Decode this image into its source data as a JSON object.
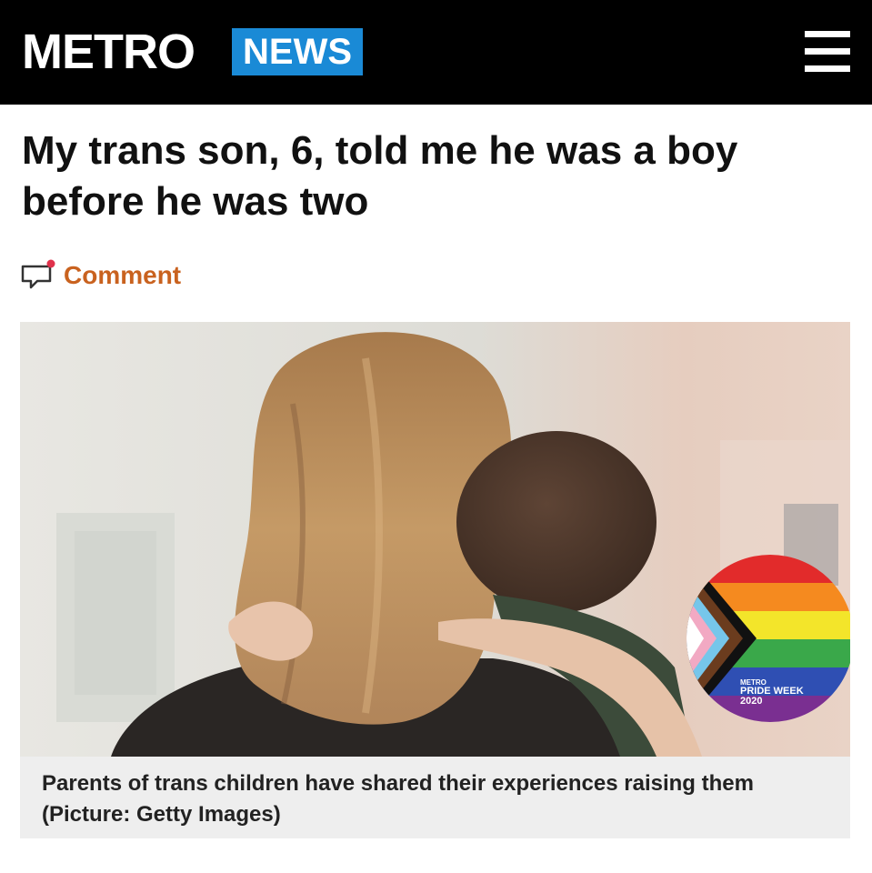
{
  "header": {
    "logo_text": "METRO",
    "section_label": "NEWS",
    "menu_icon": "hamburger-menu-icon",
    "background_color": "#000000",
    "section_color": "#1a8ad6"
  },
  "article": {
    "headline": "My trans son, 6, told me he was a boy before he was two",
    "comment_icon": "comment-bubble-icon",
    "comment_label": "Comment",
    "comment_color": "#c9621f"
  },
  "hero_image": {
    "badge_brand": "METRO",
    "badge_line_1": "PRIDE WEEK",
    "badge_line_2": "2020"
  },
  "caption": {
    "text": "Parents of trans children have shared their experiences raising them (Picture: Getty Images)"
  }
}
